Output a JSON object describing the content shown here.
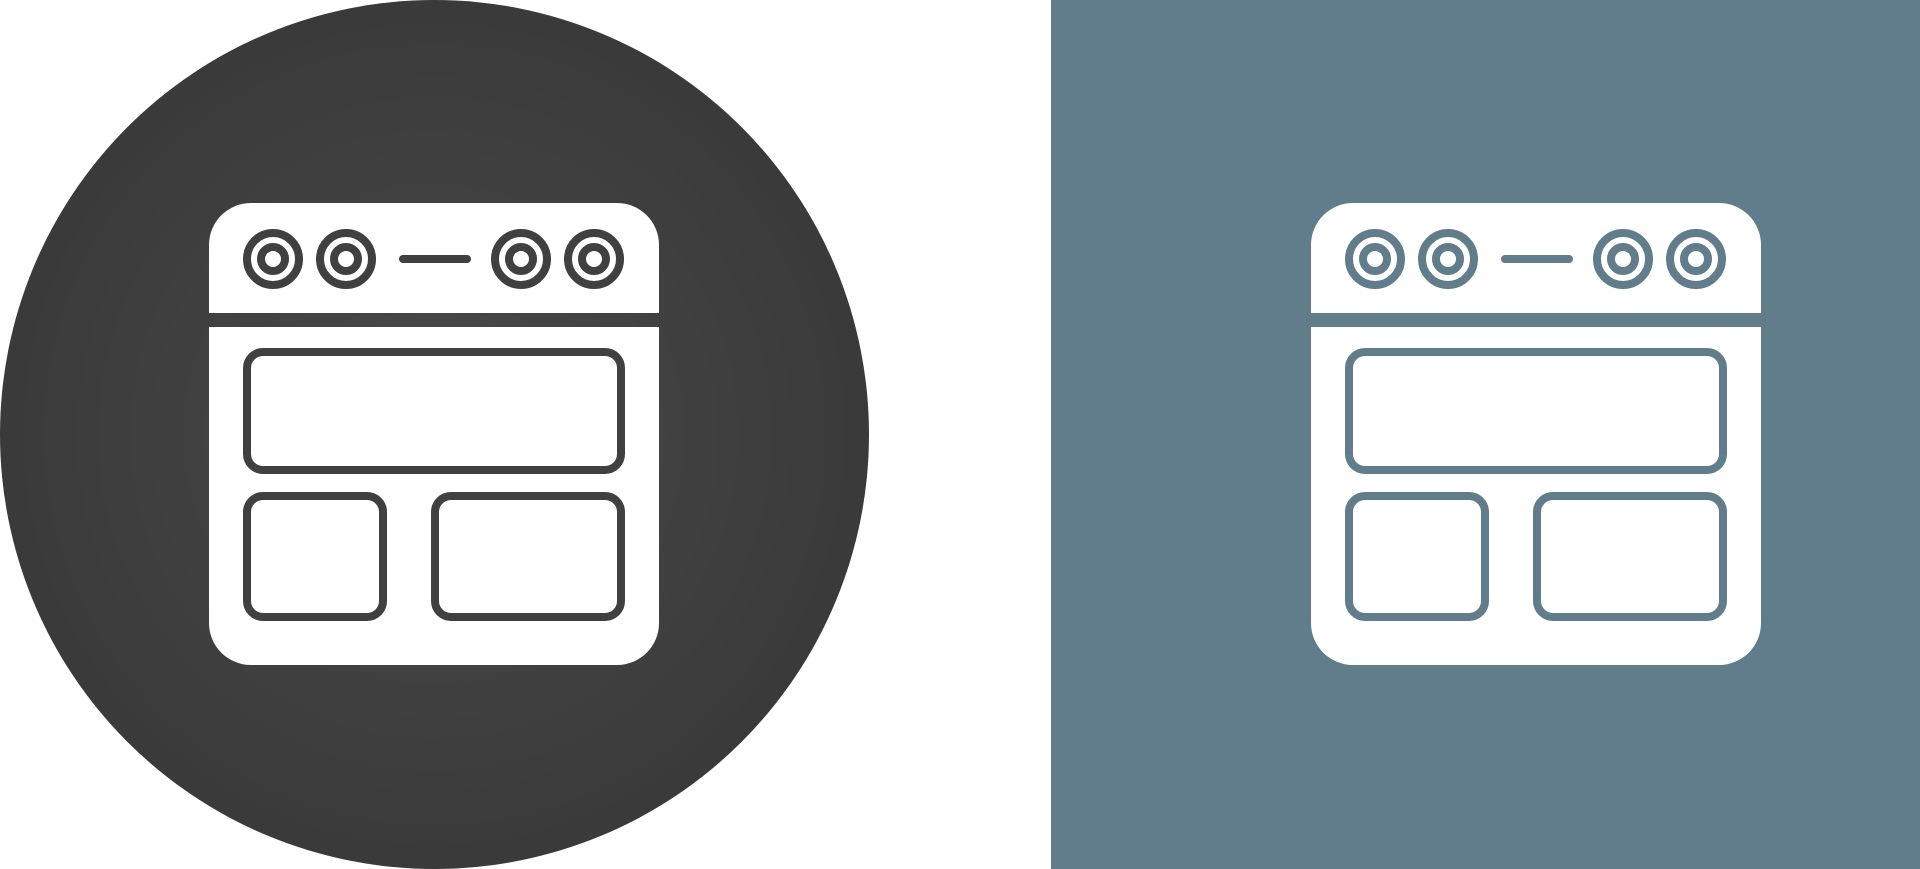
{
  "colors": {
    "page_background": "#ffffff",
    "circle_center": "#4a4a4a",
    "circle_edge": "#333333",
    "square_background": "#617d8b",
    "icon_fill": "#ffffff"
  },
  "left_icon": {
    "icon_name": "browser-layout-icon",
    "background_shape": "circle",
    "stroke_color": "#404040"
  },
  "right_icon": {
    "icon_name": "browser-layout-icon",
    "background_shape": "square",
    "stroke_color": "#617d8b"
  }
}
